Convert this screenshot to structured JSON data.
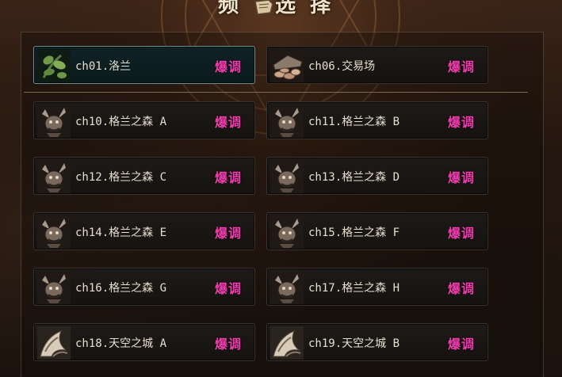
{
  "screen": {
    "title_left": "频",
    "title_right": "选择"
  },
  "difficulty_label": "爆调",
  "dungeons": [
    {
      "name": "ch01.洛兰",
      "icon": "vine-leaf-icon",
      "selected": true
    },
    {
      "name": "ch06.交易场",
      "icon": "coin-pile-icon",
      "selected": false
    },
    {
      "name": "ch10.格兰之森 A",
      "icon": "goblin-icon",
      "selected": false
    },
    {
      "name": "ch11.格兰之森 B",
      "icon": "goblin-icon",
      "selected": false
    },
    {
      "name": "ch12.格兰之森 C",
      "icon": "goblin-icon",
      "selected": false
    },
    {
      "name": "ch13.格兰之森 D",
      "icon": "goblin-icon",
      "selected": false
    },
    {
      "name": "ch14.格兰之森 E",
      "icon": "goblin-icon",
      "selected": false
    },
    {
      "name": "ch15.格兰之森 F",
      "icon": "goblin-icon",
      "selected": false
    },
    {
      "name": "ch16.格兰之森 G",
      "icon": "goblin-icon",
      "selected": false
    },
    {
      "name": "ch17.格兰之森 H",
      "icon": "goblin-icon",
      "selected": false
    },
    {
      "name": "ch18.天空之城 A",
      "icon": "sky-claw-icon",
      "selected": false
    },
    {
      "name": "ch19.天空之城 B",
      "icon": "sky-claw-icon",
      "selected": false
    }
  ],
  "colors": {
    "difficulty": "#f03cae",
    "selected_border": "#6f8e8f"
  }
}
